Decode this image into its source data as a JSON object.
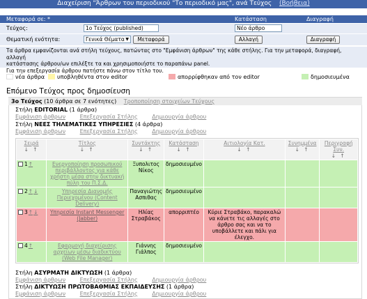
{
  "header": {
    "title": "Διαχείριση \"Άρθρων του περιοδικού \"Το περιοδικό μας\", ανά Τεύχος",
    "help": "(Βοήθεια)"
  },
  "controls": {
    "col_move": "Μεταφορά σε: *",
    "col_status": "Κατάσταση",
    "col_delete": "Διαγραφή",
    "issue_label": "Τεύχος:",
    "issue_value": "1ο Τεύχος (published)",
    "section_label": "Θεματική ενότητα:",
    "section_value": "Γενικά Θέματα",
    "move_button": "Μεταφορά",
    "status_value": "Νέο άρθρο",
    "change_button": "Αλλαγή",
    "delete_button": "Διαγραφή"
  },
  "info": {
    "line1": "Τα άρθρα εμφανίζονται ανά στήλη τεύχους, πατώντας στο \"Εμφάνιση άρθρων\" της κάθε στήλης. Για την μεταφορά, διαγραφή, αλλαγή",
    "line2": "κατάστασης άρθρου/ων επιλέξτε τα και χρησιμοποιήστε το παραπάνω panel.",
    "line3": "Για την επεξεργασία άρθρου πατήστε πάνω στον τίτλο του."
  },
  "legend": [
    {
      "label": "νέα άρθρα",
      "color": "#ffffff"
    },
    {
      "label": "υποβληθέντα στον editor",
      "color": "#fff6a8"
    },
    {
      "label": "απορρίφθηκαν από τον editor",
      "color": "#f5a9ab"
    },
    {
      "label": "δημοσιευμένα",
      "color": "#c5f0b4"
    }
  ],
  "next_issue": {
    "title": "Επόμενο Τεύχος προς δημοσίευση",
    "issue_name": "3ο Τεύχος",
    "issue_meta": "(10 άρθρα σε 7 ενότητες)",
    "issue_edit": "Τροποποίηση στοιχείων Τεύχους"
  },
  "columns": [
    {
      "prefix": "Στήλη",
      "name": "EDITORIAL",
      "count": "(1 άρθρα)"
    },
    {
      "prefix": "Στήλη",
      "name": "ΝΕΕΣ ΤΗΛΕΜΑΤΙΚΕΣ ΥΠΗΡΕΣΙΕΣ",
      "count": "(4 άρθρα)"
    },
    {
      "prefix": "Στήλη",
      "name": "ΑΣΥΡΜΑΤΗ ΔΙΚΤΥΩΣΗ",
      "count": "(1 άρθρα)"
    },
    {
      "prefix": "Στήλη",
      "name": "ΔΙΚΤΥΩΣΗ ΠΡΩΤΟΒΑΘΜΙΑΣ ΕΚΠΑΙΔΕΥΣΗΣ",
      "count": "(1 άρθρα)"
    }
  ],
  "column_links": {
    "show": "Εμφάνιση άρθρων",
    "edit": "Επεξεργασία Στήλης",
    "create": "Δημιουργία άρθρου"
  },
  "table": {
    "headers": {
      "order": "Σειρά",
      "title": "Τίτλος",
      "author": "Συντάκτης",
      "status": "Κατάσταση",
      "eval": "Αιτιολογία Κατ.",
      "count": "Συνημμένα",
      "desc": "Περιγραφή Συν.",
      "arrows": "↓ ↑"
    },
    "rows": [
      {
        "order": "1",
        "title": "Ενεργοποίηση προσωπικού περιβάλλοντος για κάθε χρήστη μέσα στην δικτυακή πύλη του Π.Σ.Δ.",
        "author": "Ξυπολιτος Νίκος",
        "status": "δημοσιευμένο",
        "eval": ""
      },
      {
        "order": "2",
        "title": "Υπηρεσία Διανομής Περιεχομένου (Content Delivery)",
        "author": "Παναγιώτης Ασπιθας",
        "status": "δημοσιευμένο",
        "eval": ""
      },
      {
        "order": "3",
        "title": "Υπηρεσία Instant Messenger (Jabber)",
        "author": "Ηλίας Στραβάκος",
        "status": "απορριπτέο",
        "eval": "Κύριε Στραβάκο, παρακαλώ να κάνετε τις αλλαγές στο άρθρο σας και να το υποβάλλετε και πάλι για έλεγχο."
      },
      {
        "order": "4",
        "title": "Εφαρμογή διαχείρισης αρχείων μέσω διαδικτύου (Web File Manager)",
        "author": "Γιάννης Γιάλπος",
        "status": "δημοσιευμένο",
        "eval": ""
      }
    ]
  }
}
